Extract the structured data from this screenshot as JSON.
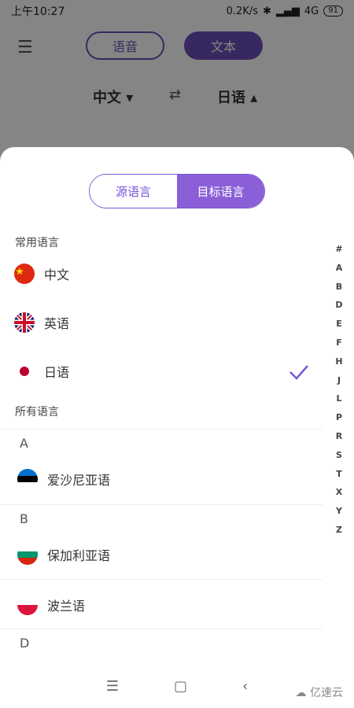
{
  "status": {
    "time": "上午10:27",
    "net": "0.2K/s",
    "signal": "4G",
    "battery": "91"
  },
  "tabs": {
    "voice": "语音",
    "text": "文本"
  },
  "langs": {
    "source": "中文",
    "target": "日语"
  },
  "sheet": {
    "segment": {
      "source": "源语言",
      "target": "目标语言"
    },
    "common_header": "常用语言",
    "all_header": "所有语言",
    "common": [
      {
        "name": "中文",
        "flag": "china"
      },
      {
        "name": "英语",
        "flag": "uk"
      },
      {
        "name": "日语",
        "flag": "japan",
        "selected": true
      }
    ],
    "groups": [
      {
        "letter": "A",
        "items": [
          {
            "name": "爱沙尼亚语",
            "flag": "estonia"
          }
        ]
      },
      {
        "letter": "B",
        "items": [
          {
            "name": "保加利亚语",
            "flag": "bulgaria"
          },
          {
            "name": "波兰语",
            "flag": "poland"
          }
        ]
      },
      {
        "letter": "D",
        "items": []
      }
    ],
    "index_letters": [
      "#",
      "A",
      "B",
      "D",
      "E",
      "F",
      "H",
      "J",
      "L",
      "P",
      "R",
      "S",
      "T",
      "X",
      "Y",
      "Z"
    ]
  },
  "watermark": "亿速云"
}
